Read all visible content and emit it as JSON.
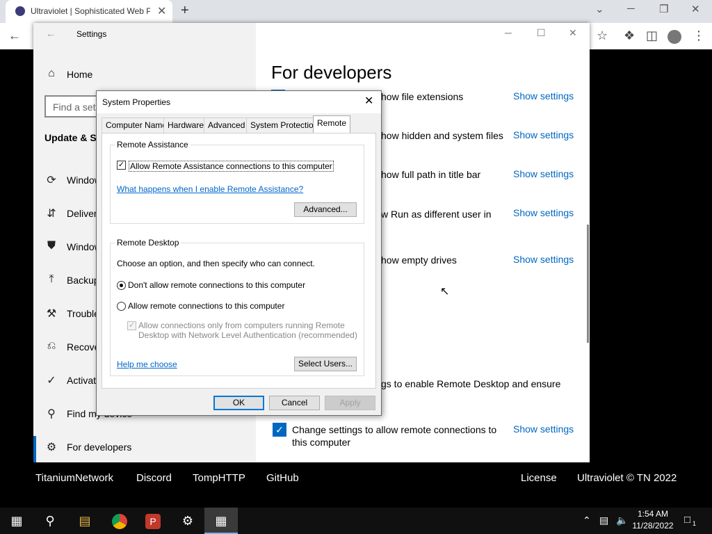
{
  "browser": {
    "tab_title": "Ultraviolet | Sophisticated Web P",
    "tab_close": "✕",
    "new_tab": "+",
    "win_min": "─",
    "win_max": "❐",
    "win_close": "✕",
    "win_dropdown": "⌄"
  },
  "footer": {
    "links": [
      "TitaniumNetwork",
      "Discord",
      "TompHTTP",
      "GitHub"
    ],
    "license": "License",
    "copyright": "Ultraviolet © TN 2022"
  },
  "settings": {
    "title": "Settings",
    "search_placeholder": "Find a setting",
    "home": "Home",
    "section": "Update & Security",
    "nav": [
      {
        "label": "Windows Update",
        "icon": "⟳"
      },
      {
        "label": "Delivery Optimization",
        "icon": "⇵"
      },
      {
        "label": "Windows Security",
        "icon": "⛊"
      },
      {
        "label": "Backup",
        "icon": "⤒"
      },
      {
        "label": "Troubleshoot",
        "icon": "⚒"
      },
      {
        "label": "Recovery",
        "icon": "⎌"
      },
      {
        "label": "Activation",
        "icon": "✓"
      },
      {
        "label": "Find my device",
        "icon": "⚲"
      },
      {
        "label": "For developers",
        "icon": "⚙"
      }
    ],
    "page_title": "For developers",
    "show_settings": "Show settings",
    "items": [
      "how file extensions",
      "how hidden and system files",
      "how full path in title bar",
      "w Run as different user in",
      "how empty drives",
      "gs to enable Remote Desktop and ensure",
      "Change settings to allow remote connections to this computer"
    ]
  },
  "dialog": {
    "title": "System Properties",
    "close": "✕",
    "tabs": [
      "Computer Name",
      "Hardware",
      "Advanced",
      "System Protection",
      "Remote"
    ],
    "active_tab": "Remote",
    "ra_group": "Remote Assistance",
    "ra_checkbox": "Allow Remote Assistance connections to this computer",
    "ra_checked": true,
    "ra_link": "What happens when I enable Remote Assistance?",
    "advanced_button": "Advanced...",
    "rd_group": "Remote Desktop",
    "rd_intro": "Choose an option, and then specify who can connect.",
    "rd_option1": "Don't allow remote connections to this computer",
    "rd_option2": "Allow remote connections to this computer",
    "rd_selected": "Don't allow remote connections to this computer",
    "nla_line1": "Allow connections only from computers running Remote",
    "nla_line2": "Desktop with Network Level Authentication (recommended)",
    "help_link": "Help me choose",
    "select_users": "Select Users...",
    "ok": "OK",
    "cancel": "Cancel",
    "apply": "Apply"
  },
  "taskbar": {
    "time": "1:54 AM",
    "date": "11/28/2022",
    "notification_count": "1"
  },
  "colors": {
    "accent": "#0067c0",
    "link": "#0066cc"
  }
}
